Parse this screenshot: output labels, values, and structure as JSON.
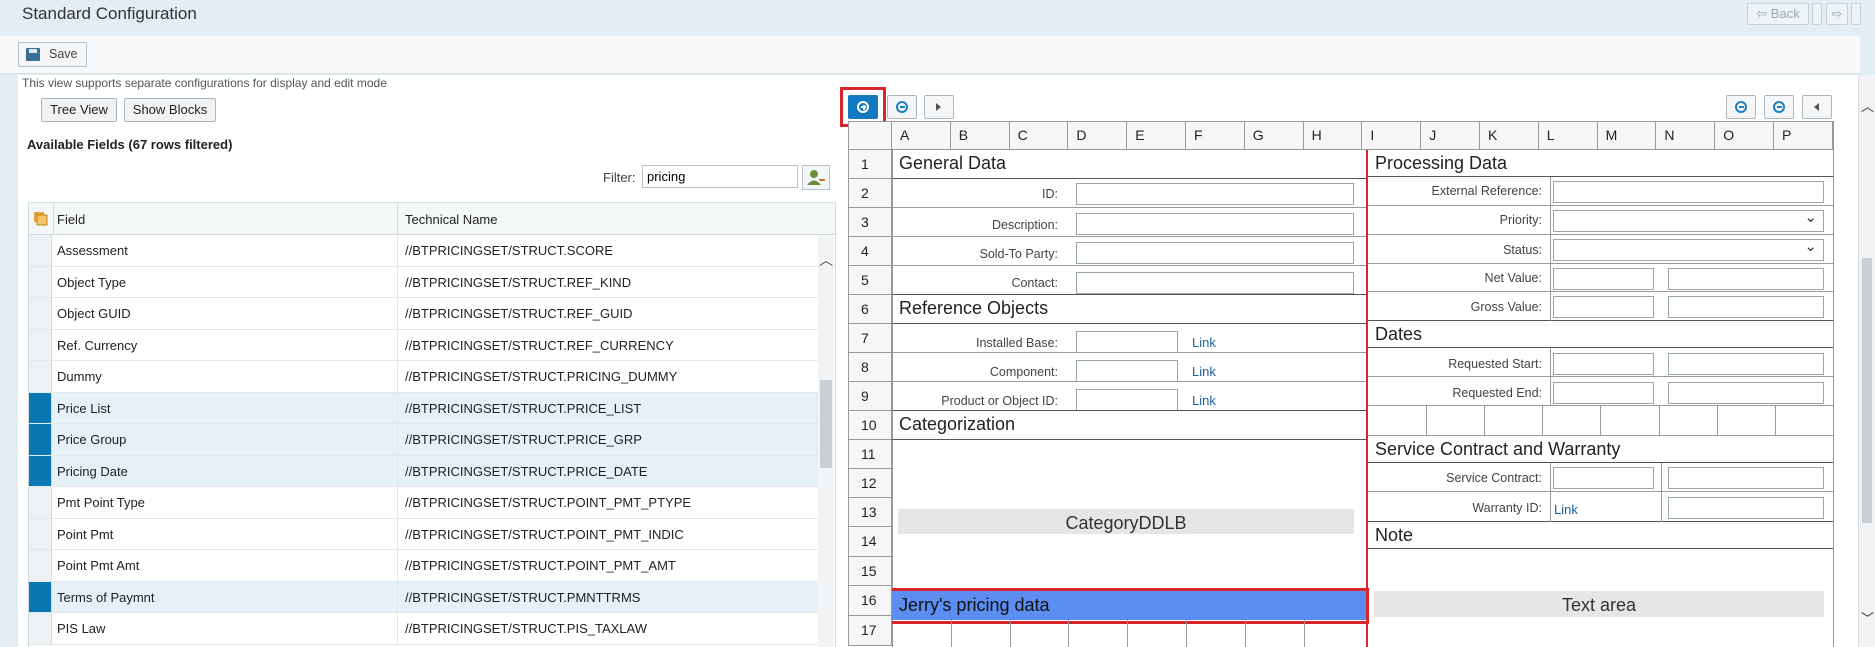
{
  "window": {
    "title": "Standard Configuration",
    "back_label": "Back"
  },
  "toolbar": {
    "save_label": "Save"
  },
  "left": {
    "hint": "This view supports separate configurations for display and edit mode",
    "tree_view_label": "Tree View",
    "show_blocks_label": "Show Blocks",
    "available_title": "Available Fields (67 rows filtered)",
    "filter_label": "Filter:",
    "filter_value": "pricing",
    "columns": {
      "field": "Field",
      "technical": "Technical Name"
    },
    "rows": [
      {
        "field": "Assessment",
        "tech": "//BTPRICINGSET/STRUCT.SCORE",
        "selected": false
      },
      {
        "field": "Object Type",
        "tech": "//BTPRICINGSET/STRUCT.REF_KIND",
        "selected": false
      },
      {
        "field": "Object GUID",
        "tech": "//BTPRICINGSET/STRUCT.REF_GUID",
        "selected": false
      },
      {
        "field": "Ref. Currency",
        "tech": "//BTPRICINGSET/STRUCT.REF_CURRENCY",
        "selected": false
      },
      {
        "field": "Dummy",
        "tech": "//BTPRICINGSET/STRUCT.PRICING_DUMMY",
        "selected": false
      },
      {
        "field": "Price List",
        "tech": "//BTPRICINGSET/STRUCT.PRICE_LIST",
        "selected": true
      },
      {
        "field": "Price Group",
        "tech": "//BTPRICINGSET/STRUCT.PRICE_GRP",
        "selected": true
      },
      {
        "field": "Pricing Date",
        "tech": "//BTPRICINGSET/STRUCT.PRICE_DATE",
        "selected": true
      },
      {
        "field": "Pmt Point Type",
        "tech": "//BTPRICINGSET/STRUCT.POINT_PMT_PTYPE",
        "selected": false
      },
      {
        "field": "Point Pmt",
        "tech": "//BTPRICINGSET/STRUCT.POINT_PMT_INDIC",
        "selected": false
      },
      {
        "field": "Point Pmt Amt",
        "tech": "//BTPRICINGSET/STRUCT.POINT_PMT_AMT",
        "selected": false
      },
      {
        "field": "Terms of Paymnt",
        "tech": "//BTPRICINGSET/STRUCT.PMNTTRMS",
        "selected": true
      },
      {
        "field": "PIS Law",
        "tech": "//BTPRICINGSET/STRUCT.PIS_TAXLAW",
        "selected": false
      }
    ]
  },
  "layout": {
    "columns": [
      "A",
      "B",
      "C",
      "D",
      "E",
      "F",
      "G",
      "H",
      "I",
      "J",
      "K",
      "L",
      "M",
      "N",
      "O",
      "P"
    ],
    "rows": [
      "1",
      "2",
      "3",
      "4",
      "5",
      "6",
      "7",
      "8",
      "9",
      "10",
      "11",
      "12",
      "13",
      "14",
      "15",
      "16",
      "17"
    ],
    "general_data": "General Data",
    "id_label": "ID:",
    "description_label": "Description:",
    "sold_to_label": "Sold-To Party:",
    "contact_label": "Contact:",
    "reference_objects": "Reference Objects",
    "installed_base_label": "Installed Base:",
    "component_label": "Component:",
    "product_label": "Product or Object ID:",
    "link": "Link",
    "categorization": "Categorization",
    "category_ddlb": "CategoryDDLB",
    "jerry_block": "Jerry's pricing data",
    "processing_data": "Processing Data",
    "external_ref_label": "External Reference:",
    "priority_label": "Priority:",
    "status_label": "Status:",
    "net_value_label": "Net Value:",
    "gross_value_label": "Gross Value:",
    "dates": "Dates",
    "requested_start_label": "Requested Start:",
    "requested_end_label": "Requested End:",
    "service_contract_section": "Service Contract and Warranty",
    "service_contract_label": "Service Contract:",
    "warranty_label": "Warranty ID:",
    "note": "Note",
    "text_area": "Text area"
  }
}
